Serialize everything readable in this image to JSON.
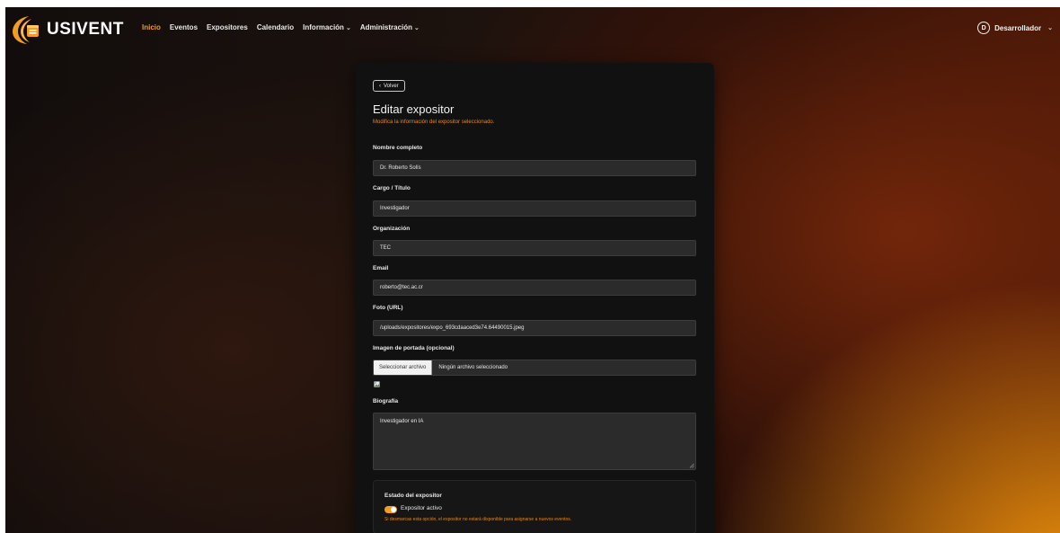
{
  "brand": {
    "name": "USIVENT",
    "accent": "#f29d1f"
  },
  "nav": {
    "items": [
      {
        "label": "Inicio",
        "active": true
      },
      {
        "label": "Eventos"
      },
      {
        "label": "Expositores"
      },
      {
        "label": "Calendario"
      },
      {
        "label": "Información",
        "dropdown": true
      },
      {
        "label": "Administración",
        "dropdown": true
      }
    ]
  },
  "user": {
    "initial": "D",
    "name": "Desarrollador"
  },
  "form": {
    "back_label": "Volver",
    "title": "Editar expositor",
    "subtitle": "Modifica la información del expositor seleccionado.",
    "fields": {
      "name": {
        "label": "Nombre completo",
        "value": "Dr. Roberto Solís"
      },
      "role": {
        "label": "Cargo / Título",
        "value": "Investigador"
      },
      "org": {
        "label": "Organización",
        "value": "TEC"
      },
      "email": {
        "label": "Email",
        "value": "roberto@tec.ac.cr"
      },
      "photo": {
        "label": "Foto (URL)",
        "value": "/uploads/expositores/expo_693cdaaced3e74.64490015.jpeg"
      },
      "cover": {
        "label": "Imagen de portada (opcional)",
        "button": "Seleccionar archivo",
        "status": "Ningún archivo seleccionado"
      },
      "bio": {
        "label": "Biografía",
        "value": "Investigador en IA"
      }
    },
    "status": {
      "title": "Estado del expositor",
      "toggle_label": "Expositor activo",
      "toggle_on": true,
      "help": "Si desmarcas esta opción, el expositor no estará disponible para asignarse a nuevos eventos."
    }
  }
}
